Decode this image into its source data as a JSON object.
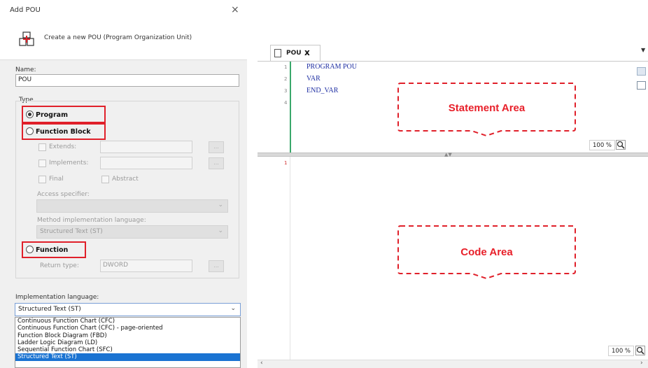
{
  "dialog": {
    "title": "Add POU",
    "close_glyph": "×",
    "header_text": "Create a new POU (Program Organization Unit)",
    "name_label": "Name:",
    "name_value": "POU",
    "type_label": "Type",
    "program_label": "Program",
    "function_block_label": "Function Block",
    "extends_label": "Extends:",
    "implements_label": "Implements:",
    "final_label": "Final",
    "abstract_label": "Abstract",
    "access_specifier_label": "Access specifier:",
    "method_impl_label": "Method implementation language:",
    "method_impl_value": "Structured Text (ST)",
    "function_label": "Function",
    "return_type_label": "Return type:",
    "return_type_value": "DWORD",
    "ellipsis": "...",
    "impl_lang_label": "Implementation language:",
    "impl_lang_value": "Structured Text (ST)",
    "impl_lang_options": [
      "Continuous Function Chart (CFC)",
      "Continuous Function Chart (CFC) - page-oriented",
      "Function Block Diagram (FBD)",
      "Ladder Logic Diagram (LD)",
      "Sequential Function Chart (SFC)",
      "Structured Text (ST)"
    ],
    "selected_type": "Program"
  },
  "editor": {
    "tab_label": "POU",
    "tab_close": "x",
    "declaration_lines": [
      {
        "num": "1",
        "code": "PROGRAM POU"
      },
      {
        "num": "2",
        "code": "VAR"
      },
      {
        "num": "3",
        "code": "END_VAR"
      },
      {
        "num": "4",
        "code": ""
      }
    ],
    "code_lines": [
      {
        "num": "1",
        "code": ""
      }
    ],
    "statement_zoom": "100 %",
    "code_zoom": "100 %",
    "statement_callout": "Statement Area",
    "code_callout": "Code Area"
  },
  "colors": {
    "highlight_red": "#e0202a",
    "code_blue": "#1f2fa3",
    "selection_blue": "#1a73d2",
    "gutter_green": "#3aa86b"
  }
}
